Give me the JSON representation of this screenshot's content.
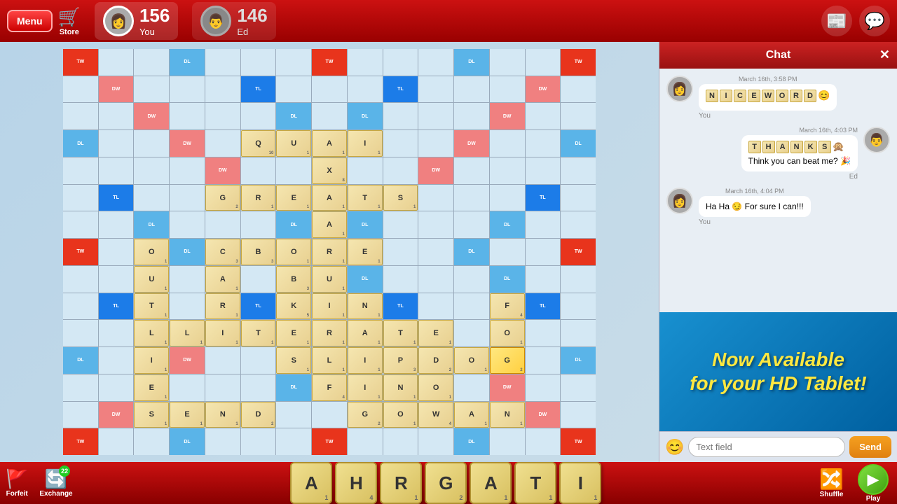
{
  "header": {
    "menu_label": "Menu",
    "store_label": "Store",
    "player1": {
      "score": "156",
      "name": "You",
      "avatar_emoji": "👩"
    },
    "player2": {
      "score": "146",
      "name": "Ed",
      "avatar_emoji": "👨"
    },
    "icons": {
      "news": "📰",
      "chat": "💬"
    }
  },
  "chat": {
    "title": "Chat",
    "close": "✕",
    "messages": [
      {
        "side": "left",
        "avatar": "👩",
        "time": "March 16th, 3:58 PM",
        "tiles": [
          "N",
          "I",
          "C",
          "E",
          "W",
          "O",
          "R",
          "D"
        ],
        "body": "😊",
        "sender": "You"
      },
      {
        "side": "right",
        "avatar": "👨",
        "time": "March 16th, 4:03 PM",
        "tiles": [
          "T",
          "H",
          "A",
          "N",
          "K",
          "S"
        ],
        "body": "🙊 Think you can beat me? 🎉",
        "sender": "Ed"
      },
      {
        "side": "left",
        "avatar": "👩",
        "time": "March 16th, 4:04 PM",
        "tiles": [],
        "body": "Ha Ha 😏 For sure I can!!!",
        "sender": "You"
      }
    ],
    "input_placeholder": "Text field",
    "send_label": "Send",
    "emoji_icon": "😊"
  },
  "promo": {
    "text": "Now Available\nfor your HD Tablet!"
  },
  "footer": {
    "forfeit_label": "Forfeit",
    "forfeit_icon": "🚩",
    "exchange_label": "Exchange",
    "exchange_icon": "🔄",
    "exchange_count": "22",
    "shuffle_label": "Shuffle",
    "shuffle_icon": "🔀",
    "play_label": "Play",
    "play_icon": "▶",
    "tiles": [
      {
        "letter": "A",
        "sub": "1"
      },
      {
        "letter": "H",
        "sub": "4"
      },
      {
        "letter": "R",
        "sub": "1"
      },
      {
        "letter": "G",
        "sub": "2"
      },
      {
        "letter": "A",
        "sub": "1"
      },
      {
        "letter": "T",
        "sub": "1"
      },
      {
        "letter": "I",
        "sub": "1"
      }
    ]
  },
  "board": {
    "accent_colors": {
      "TW": "#e8341c",
      "DW": "#f08080",
      "TL": "#1c7ce8",
      "DL": "#5ab4e8"
    }
  }
}
